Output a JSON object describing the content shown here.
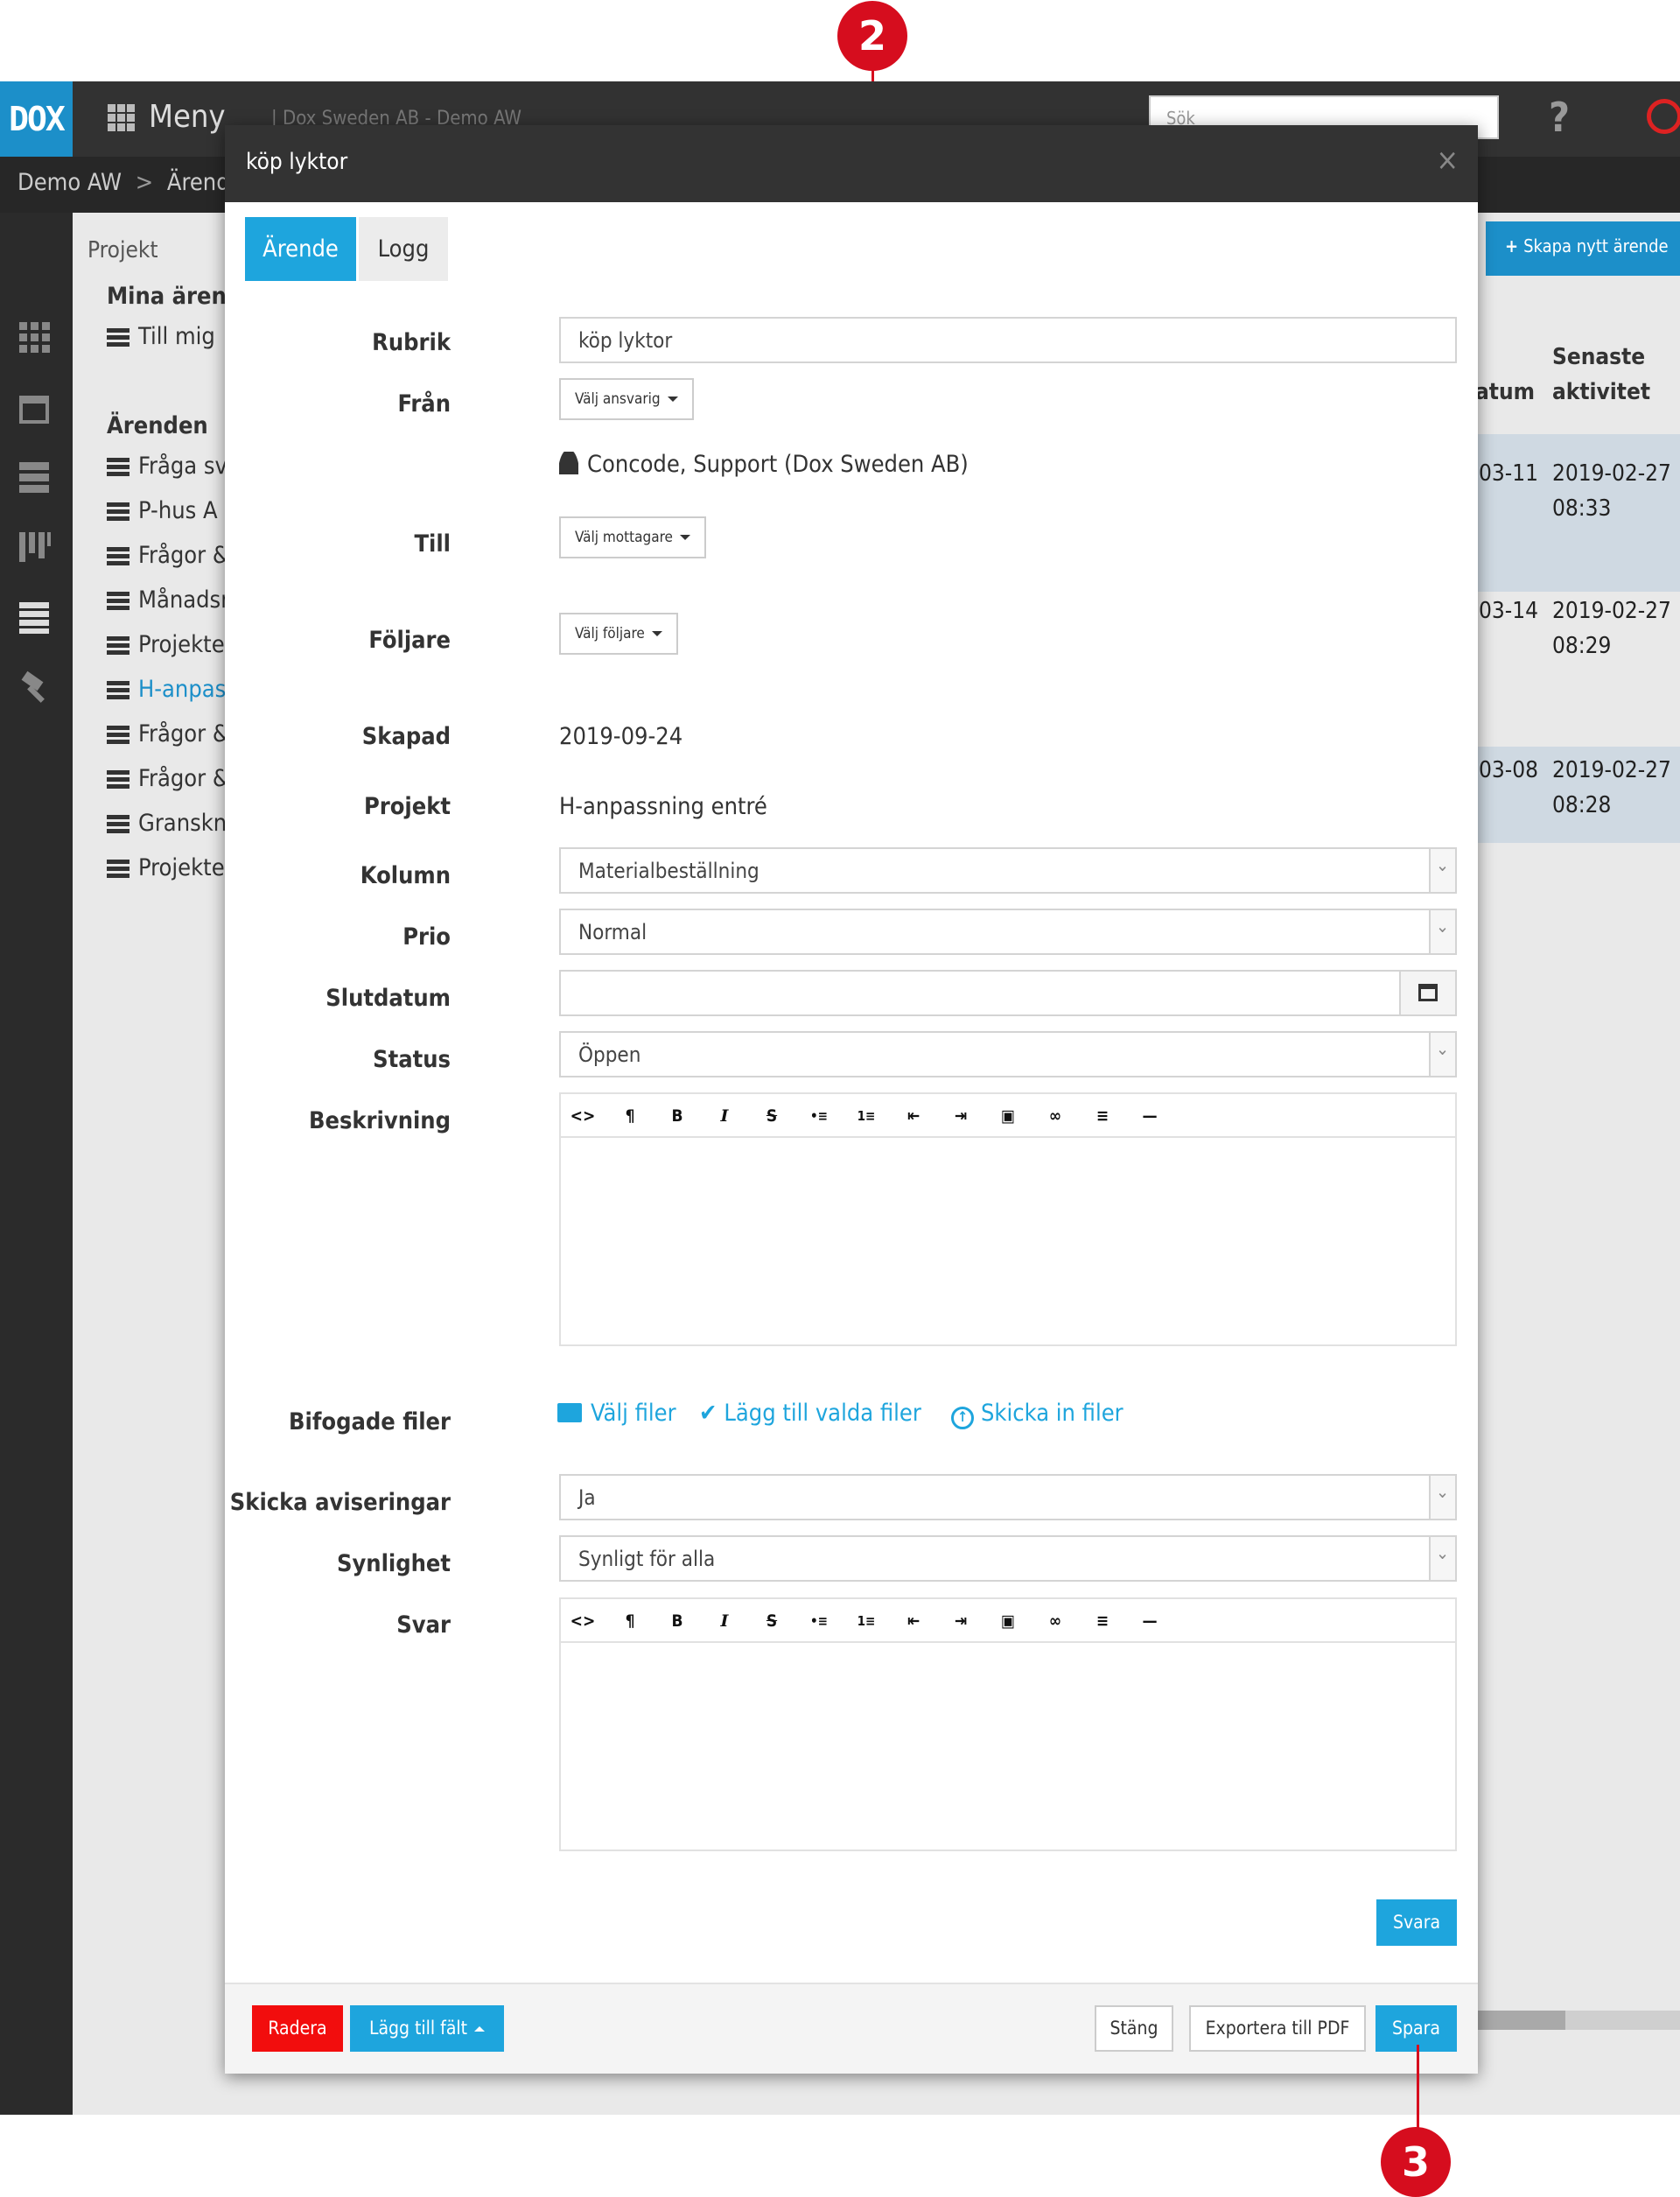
{
  "annotations": {
    "marker_top": "2",
    "marker_bottom": "3"
  },
  "topbar": {
    "logo": "DOX",
    "menu_label": "Meny",
    "company": "| Dox Sweden AB - Demo AW",
    "search_placeholder": "Sök",
    "help": "?"
  },
  "breadcrumb": {
    "root": "Demo AW",
    "sep": ">",
    "page": "Ärende"
  },
  "left_panel": {
    "projects_header": "Projekt",
    "my_cases": "Mina ärenden",
    "to_me": "Till mig",
    "cases_header": "Ärenden",
    "items": [
      "Fråga sv",
      "P-hus A",
      "Frågor &",
      "Månadsr",
      "Projekte",
      "H-anpas",
      "Frågor &",
      "Frågor &",
      "Granskni",
      "Projekte"
    ]
  },
  "right_panel": {
    "new_button": "Skapa nytt ärende",
    "col_date": "atum",
    "col_activity_1": "Senaste",
    "col_activity_2": "aktivitet",
    "rows": [
      {
        "date": "03-11",
        "activity": "2019-02-27",
        "time": "08:33"
      },
      {
        "date": "03-14",
        "activity": "2019-02-27",
        "time": "08:29"
      },
      {
        "date": "03-08",
        "activity": "2019-02-27",
        "time": "08:28"
      }
    ]
  },
  "modal": {
    "title": "köp lyktor",
    "close": "×",
    "tabs": {
      "active": "Ärende",
      "log": "Logg"
    },
    "labels": {
      "rubrik": "Rubrik",
      "fran": "Från",
      "till": "Till",
      "foljare": "Följare",
      "skapad": "Skapad",
      "projekt": "Projekt",
      "kolumn": "Kolumn",
      "prio": "Prio",
      "slutdatum": "Slutdatum",
      "status": "Status",
      "beskrivning": "Beskrivning",
      "bifogade": "Bifogade filer",
      "aviseringar": "Skicka aviseringar",
      "synlighet": "Synlighet",
      "svar": "Svar"
    },
    "values": {
      "rubrik": "köp lyktor",
      "fran_button": "Välj ansvarig",
      "fran_person": "Concode, Support (Dox Sweden AB)",
      "till_button": "Välj mottagare",
      "foljare_button": "Välj följare",
      "skapad": "2019-09-24",
      "projekt": "H-anpassning entré",
      "kolumn": "Materialbeställning",
      "prio": "Normal",
      "slutdatum": "",
      "status": "Öppen",
      "aviseringar": "Ja",
      "synlighet": "Synligt för alla"
    },
    "files": {
      "choose": "Välj filer",
      "add": "Lägg till valda filer",
      "send": "Skicka in filer"
    },
    "editor_tools": [
      "<>",
      "¶",
      "B",
      "I",
      "S",
      "•≡",
      "1≡",
      "⇤",
      "⇥",
      "▣",
      "∞",
      "≡",
      "—"
    ],
    "reply_button": "Svara",
    "footer": {
      "delete": "Radera",
      "add_field": "Lägg till fält",
      "close": "Stäng",
      "export": "Exportera till PDF",
      "save": "Spara"
    }
  }
}
